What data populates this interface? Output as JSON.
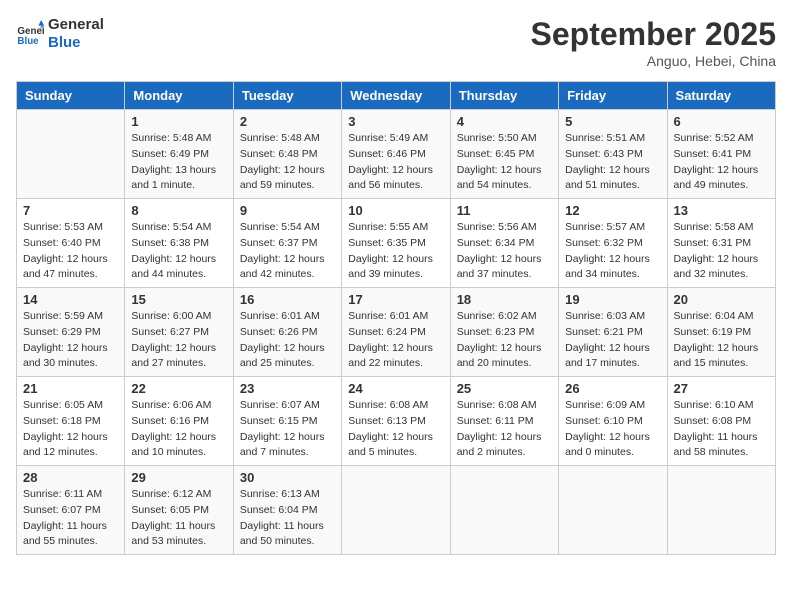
{
  "header": {
    "logo_general": "General",
    "logo_blue": "Blue",
    "month_title": "September 2025",
    "location": "Anguo, Hebei, China"
  },
  "days_of_week": [
    "Sunday",
    "Monday",
    "Tuesday",
    "Wednesday",
    "Thursday",
    "Friday",
    "Saturday"
  ],
  "weeks": [
    [
      {
        "day": "",
        "info": ""
      },
      {
        "day": "1",
        "info": "Sunrise: 5:48 AM\nSunset: 6:49 PM\nDaylight: 13 hours\nand 1 minute."
      },
      {
        "day": "2",
        "info": "Sunrise: 5:48 AM\nSunset: 6:48 PM\nDaylight: 12 hours\nand 59 minutes."
      },
      {
        "day": "3",
        "info": "Sunrise: 5:49 AM\nSunset: 6:46 PM\nDaylight: 12 hours\nand 56 minutes."
      },
      {
        "day": "4",
        "info": "Sunrise: 5:50 AM\nSunset: 6:45 PM\nDaylight: 12 hours\nand 54 minutes."
      },
      {
        "day": "5",
        "info": "Sunrise: 5:51 AM\nSunset: 6:43 PM\nDaylight: 12 hours\nand 51 minutes."
      },
      {
        "day": "6",
        "info": "Sunrise: 5:52 AM\nSunset: 6:41 PM\nDaylight: 12 hours\nand 49 minutes."
      }
    ],
    [
      {
        "day": "7",
        "info": "Sunrise: 5:53 AM\nSunset: 6:40 PM\nDaylight: 12 hours\nand 47 minutes."
      },
      {
        "day": "8",
        "info": "Sunrise: 5:54 AM\nSunset: 6:38 PM\nDaylight: 12 hours\nand 44 minutes."
      },
      {
        "day": "9",
        "info": "Sunrise: 5:54 AM\nSunset: 6:37 PM\nDaylight: 12 hours\nand 42 minutes."
      },
      {
        "day": "10",
        "info": "Sunrise: 5:55 AM\nSunset: 6:35 PM\nDaylight: 12 hours\nand 39 minutes."
      },
      {
        "day": "11",
        "info": "Sunrise: 5:56 AM\nSunset: 6:34 PM\nDaylight: 12 hours\nand 37 minutes."
      },
      {
        "day": "12",
        "info": "Sunrise: 5:57 AM\nSunset: 6:32 PM\nDaylight: 12 hours\nand 34 minutes."
      },
      {
        "day": "13",
        "info": "Sunrise: 5:58 AM\nSunset: 6:31 PM\nDaylight: 12 hours\nand 32 minutes."
      }
    ],
    [
      {
        "day": "14",
        "info": "Sunrise: 5:59 AM\nSunset: 6:29 PM\nDaylight: 12 hours\nand 30 minutes."
      },
      {
        "day": "15",
        "info": "Sunrise: 6:00 AM\nSunset: 6:27 PM\nDaylight: 12 hours\nand 27 minutes."
      },
      {
        "day": "16",
        "info": "Sunrise: 6:01 AM\nSunset: 6:26 PM\nDaylight: 12 hours\nand 25 minutes."
      },
      {
        "day": "17",
        "info": "Sunrise: 6:01 AM\nSunset: 6:24 PM\nDaylight: 12 hours\nand 22 minutes."
      },
      {
        "day": "18",
        "info": "Sunrise: 6:02 AM\nSunset: 6:23 PM\nDaylight: 12 hours\nand 20 minutes."
      },
      {
        "day": "19",
        "info": "Sunrise: 6:03 AM\nSunset: 6:21 PM\nDaylight: 12 hours\nand 17 minutes."
      },
      {
        "day": "20",
        "info": "Sunrise: 6:04 AM\nSunset: 6:19 PM\nDaylight: 12 hours\nand 15 minutes."
      }
    ],
    [
      {
        "day": "21",
        "info": "Sunrise: 6:05 AM\nSunset: 6:18 PM\nDaylight: 12 hours\nand 12 minutes."
      },
      {
        "day": "22",
        "info": "Sunrise: 6:06 AM\nSunset: 6:16 PM\nDaylight: 12 hours\nand 10 minutes."
      },
      {
        "day": "23",
        "info": "Sunrise: 6:07 AM\nSunset: 6:15 PM\nDaylight: 12 hours\nand 7 minutes."
      },
      {
        "day": "24",
        "info": "Sunrise: 6:08 AM\nSunset: 6:13 PM\nDaylight: 12 hours\nand 5 minutes."
      },
      {
        "day": "25",
        "info": "Sunrise: 6:08 AM\nSunset: 6:11 PM\nDaylight: 12 hours\nand 2 minutes."
      },
      {
        "day": "26",
        "info": "Sunrise: 6:09 AM\nSunset: 6:10 PM\nDaylight: 12 hours\nand 0 minutes."
      },
      {
        "day": "27",
        "info": "Sunrise: 6:10 AM\nSunset: 6:08 PM\nDaylight: 11 hours\nand 58 minutes."
      }
    ],
    [
      {
        "day": "28",
        "info": "Sunrise: 6:11 AM\nSunset: 6:07 PM\nDaylight: 11 hours\nand 55 minutes."
      },
      {
        "day": "29",
        "info": "Sunrise: 6:12 AM\nSunset: 6:05 PM\nDaylight: 11 hours\nand 53 minutes."
      },
      {
        "day": "30",
        "info": "Sunrise: 6:13 AM\nSunset: 6:04 PM\nDaylight: 11 hours\nand 50 minutes."
      },
      {
        "day": "",
        "info": ""
      },
      {
        "day": "",
        "info": ""
      },
      {
        "day": "",
        "info": ""
      },
      {
        "day": "",
        "info": ""
      }
    ]
  ]
}
